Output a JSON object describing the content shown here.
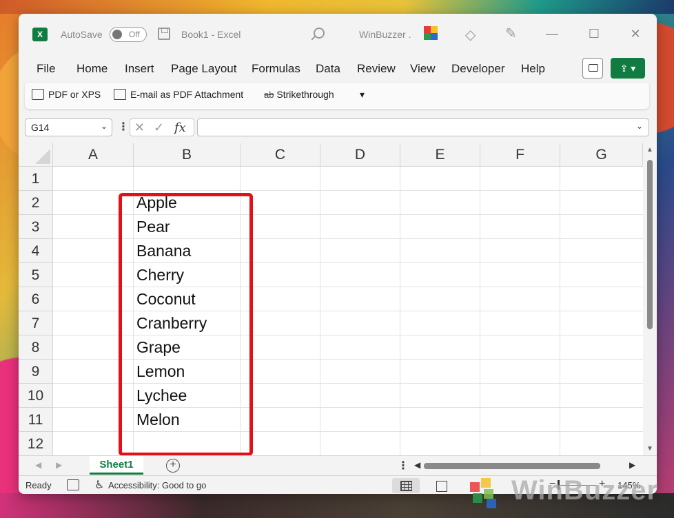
{
  "titlebar": {
    "autosave_label": "AutoSave",
    "autosave_state": "Off",
    "document_title": "Book1  -  Excel",
    "user_name": "WinBuzzer ."
  },
  "menu": {
    "items": [
      "File",
      "Home",
      "Insert",
      "Page Layout",
      "Formulas",
      "Data",
      "Review",
      "View",
      "Developer",
      "Help"
    ]
  },
  "quick_toolbar": {
    "pdf_xps": "PDF or XPS",
    "email_pdf": "E-mail as PDF Attachment",
    "strikethrough": "Strikethrough",
    "strike_icon_text": "ab",
    "more": "▾"
  },
  "formula_bar": {
    "name_box": "G14",
    "formula": ""
  },
  "grid": {
    "columns": [
      "A",
      "B",
      "C",
      "D",
      "E",
      "F",
      "G"
    ],
    "rows": [
      "1",
      "2",
      "3",
      "4",
      "5",
      "6",
      "7",
      "8",
      "9",
      "10",
      "11",
      "12"
    ],
    "column_b_values": [
      "Apple",
      "Pear",
      "Banana",
      "Cherry",
      "Coconut",
      "Cranberry",
      "Grape",
      "Lemon",
      "Lychee",
      "Melon"
    ]
  },
  "sheets": {
    "active": "Sheet1"
  },
  "status": {
    "ready": "Ready",
    "accessibility": "Accessibility: Good to go",
    "zoom": "145%"
  },
  "watermark": {
    "text": "WinBuzzer"
  },
  "colors": {
    "excel_green": "#107c41",
    "highlight_red": "#e3101a"
  }
}
